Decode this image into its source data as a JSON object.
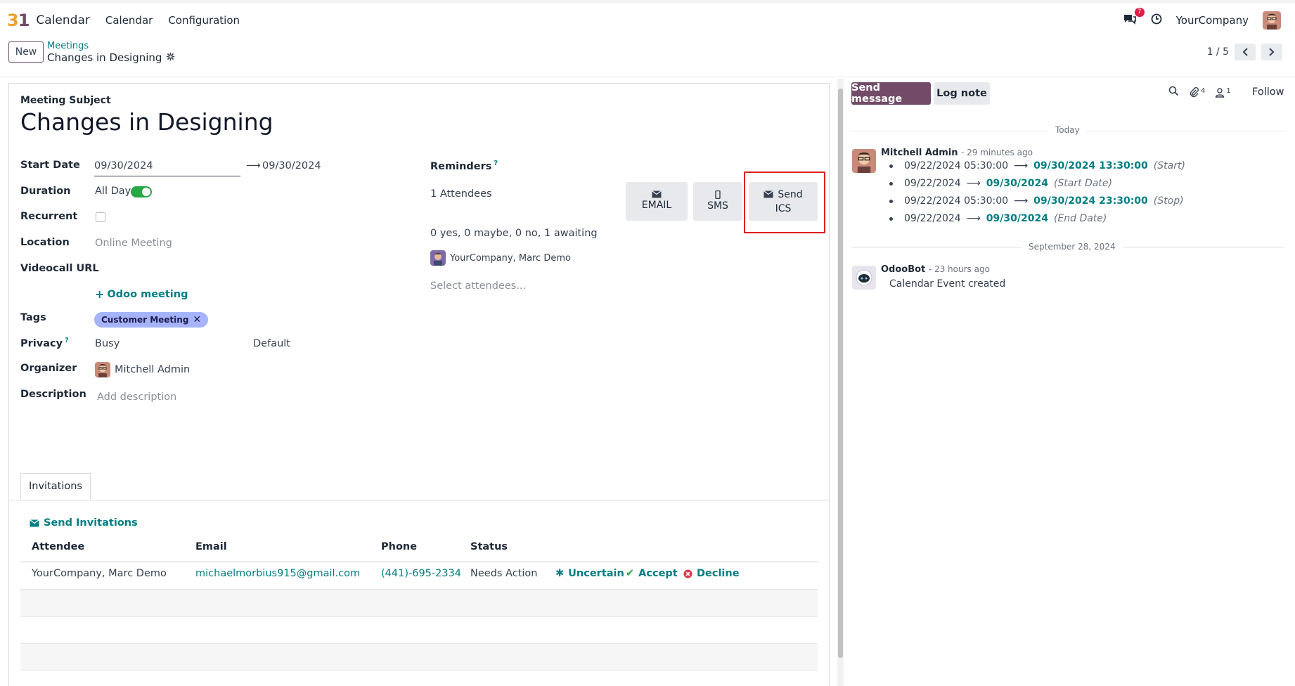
{
  "navbar": {
    "logo_text_a": "3",
    "logo_text_b": "1",
    "app_name": "Calendar",
    "menu": [
      "Calendar",
      "Configuration"
    ],
    "message_count": "7",
    "company": "YourCompany"
  },
  "control_panel": {
    "new_label": "New",
    "breadcrumb_parent": "Meetings",
    "breadcrumb_current": "Changes in Designing",
    "pager": "1 / 5"
  },
  "form": {
    "subject_label": "Meeting Subject",
    "subject": "Changes in Designing",
    "start_date_label": "Start Date",
    "start_date": "09/30/2024",
    "end_date": "09/30/2024",
    "duration_label": "Duration",
    "all_day_label": "All Day",
    "recurrent_label": "Recurrent",
    "location_label": "Location",
    "location_value": "Online Meeting",
    "videocall_label": "Videocall URL",
    "odoo_meeting": "Odoo meeting",
    "tags_label": "Tags",
    "tag": "Customer Meeting",
    "privacy_label": "Privacy",
    "privacy_value": "Busy",
    "privacy_default": "Default",
    "organizer_label": "Organizer",
    "organizer": "Mitchell Admin",
    "description_label": "Description",
    "description_placeholder": "Add description",
    "reminders_label": "Reminders",
    "attendees_count": "1 Attendees",
    "attendee_summary": "0 yes, 0 maybe, 0 no, 1 awaiting",
    "attendee_chip": "YourCompany, Marc Demo",
    "select_attendees": "Select attendees...",
    "btn_email": "EMAIL",
    "btn_sms": "SMS",
    "btn_send_line1": "Send",
    "btn_send_line2": "ICS"
  },
  "invitations": {
    "tab_label": "Invitations",
    "send_label": "Send Invitations",
    "headers": [
      "Attendee",
      "Email",
      "Phone",
      "Status"
    ],
    "row": {
      "attendee": "YourCompany, Marc Demo",
      "email": "michaelmorbius915@gmail.com",
      "phone": "(441)-695-2334",
      "status": "Needs Action",
      "uncertain": "Uncertain",
      "accept": "Accept",
      "decline": "Decline"
    }
  },
  "chatter": {
    "send_message": "Send message",
    "log_note": "Log note",
    "attachments_count": "4",
    "followers_count": "1",
    "follow": "Follow",
    "sep_today": "Today",
    "msg1_author": "Mitchell Admin",
    "msg1_time": "- 29 minutes ago",
    "changes": [
      {
        "old": "09/22/2024 05:30:00",
        "new": "09/30/2024 13:30:00",
        "field": "(Start)"
      },
      {
        "old": "09/22/2024",
        "new": "09/30/2024",
        "field": "(Start Date)"
      },
      {
        "old": "09/22/2024 05:30:00",
        "new": "09/30/2024 23:30:00",
        "field": "(Stop)"
      },
      {
        "old": "09/22/2024",
        "new": "09/30/2024",
        "field": "(End Date)"
      }
    ],
    "sep_date": "September 28, 2024",
    "msg2_author": "OdooBot",
    "msg2_time": "- 23 hours ago",
    "msg2_body": "Calendar Event created"
  }
}
